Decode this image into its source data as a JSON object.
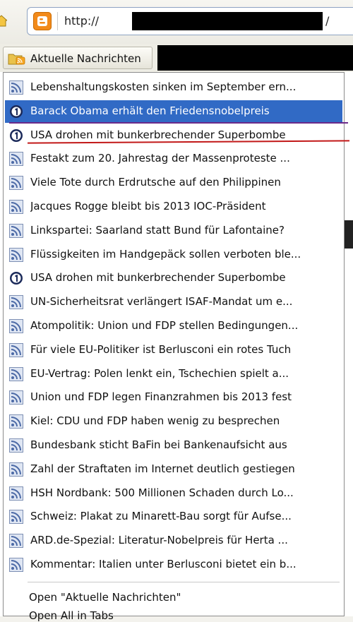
{
  "urlbar": {
    "url_prefix": "http://",
    "url_suffix": "/"
  },
  "bookmarks_toolbar": {
    "folder_label": "Aktuelle Nachrichten"
  },
  "menu": {
    "items": [
      {
        "icon": "rss-icon",
        "label": "Lebenshaltungskosten sinken im September ern..."
      },
      {
        "icon": "ard-logo-icon",
        "label": "Barack Obama erhält den Friedensnobelpreis"
      },
      {
        "icon": "ard-logo-icon",
        "label": "USA drohen mit bunkerbrechender Superbombe"
      },
      {
        "icon": "rss-icon",
        "label": "Festakt zum 20. Jahrestag der Massenproteste ..."
      },
      {
        "icon": "rss-icon",
        "label": "Viele Tote durch Erdrutsche auf den Philippinen"
      },
      {
        "icon": "rss-icon",
        "label": "Jacques Rogge bleibt bis 2013 IOC-Präsident"
      },
      {
        "icon": "rss-icon",
        "label": "Linkspartei: Saarland statt Bund für Lafontaine?"
      },
      {
        "icon": "rss-icon",
        "label": "Flüssigkeiten im Handgepäck sollen verboten ble..."
      },
      {
        "icon": "ard-logo-icon",
        "label": "USA drohen mit bunkerbrechender Superbombe"
      },
      {
        "icon": "rss-icon",
        "label": "UN-Sicherheitsrat verlängert ISAF-Mandat um e..."
      },
      {
        "icon": "rss-icon",
        "label": "Atompolitik: Union und FDP stellen Bedingungen..."
      },
      {
        "icon": "rss-icon",
        "label": "Für viele EU-Politiker ist Berlusconi ein rotes Tuch"
      },
      {
        "icon": "rss-icon",
        "label": "EU-Vertrag: Polen lenkt ein, Tschechien spielt a..."
      },
      {
        "icon": "rss-icon",
        "label": "Union und FDP legen Finanzrahmen bis 2013 fest"
      },
      {
        "icon": "rss-icon",
        "label": "Kiel: CDU und FDP haben wenig zu besprechen"
      },
      {
        "icon": "rss-icon",
        "label": "Bundesbank sticht BaFin bei Bankenaufsicht aus"
      },
      {
        "icon": "rss-icon",
        "label": "Zahl der Straftaten im Internet deutlich gestiegen"
      },
      {
        "icon": "rss-icon",
        "label": "HSH Nordbank: 500 Millionen Schaden durch Lo..."
      },
      {
        "icon": "rss-icon",
        "label": "Schweiz: Plakat zu Minarett-Bau sorgt für Aufse..."
      },
      {
        "icon": "rss-icon",
        "label": "ARD.de-Spezial: Literatur-Nobelpreis für Herta ..."
      },
      {
        "icon": "rss-icon",
        "label": "Kommentar: Italien unter Berlusconi bietet ein b..."
      }
    ],
    "selected_index": 1,
    "footer": {
      "open_label": "Open \"Aktuelle Nachrichten\"",
      "open_all_label": "Open All in Tabs"
    }
  },
  "colors": {
    "selection": "#316ac5",
    "annotation_purple": "#6b2a8a",
    "annotation_red": "#c21818",
    "blogger_orange": "#f28a1a",
    "rss_orange": "#f5a623"
  }
}
